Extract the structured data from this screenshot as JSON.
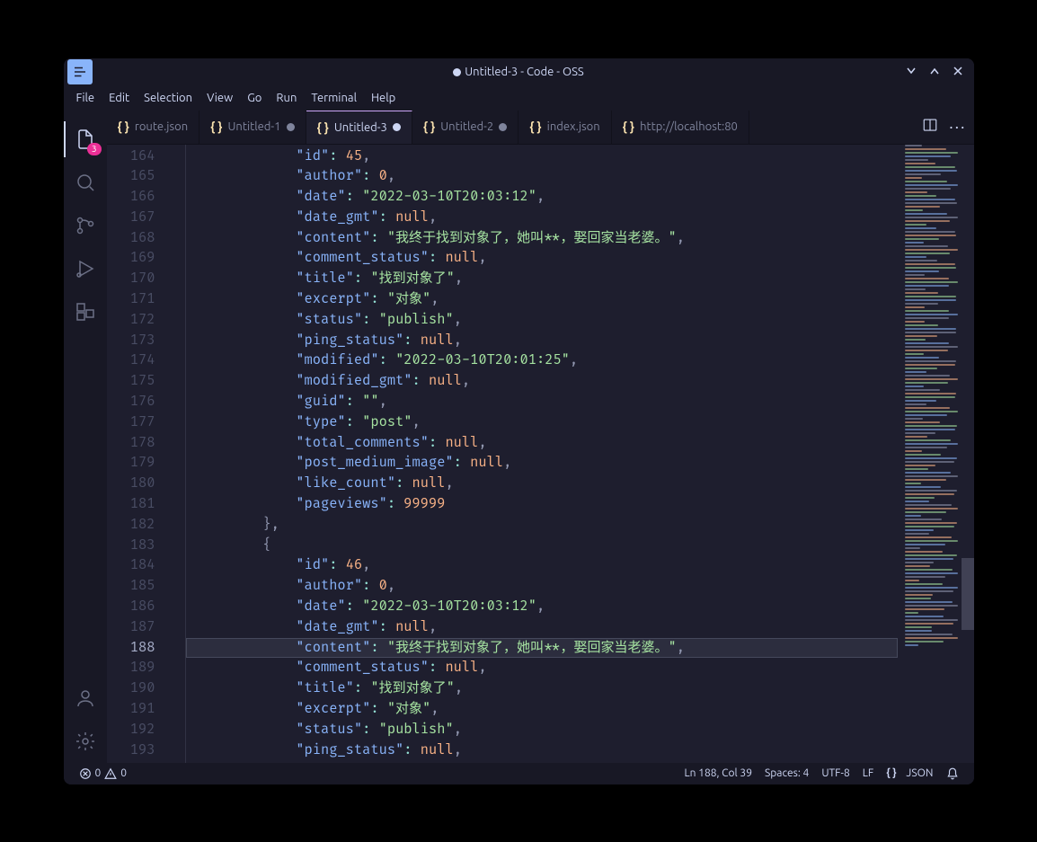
{
  "window_title": "Untitled-3 - Code - OSS",
  "menu": [
    "File",
    "Edit",
    "Selection",
    "View",
    "Go",
    "Run",
    "Terminal",
    "Help"
  ],
  "activity_badge": "3",
  "tabs": [
    {
      "label": "route.json",
      "dirty": false
    },
    {
      "label": "Untitled-1",
      "dirty": true
    },
    {
      "label": "Untitled-3",
      "dirty": true,
      "active": true
    },
    {
      "label": "Untitled-2",
      "dirty": true
    },
    {
      "label": "index.json",
      "dirty": false
    },
    {
      "label": "http://localhost:80",
      "dirty": false,
      "truncated": true
    }
  ],
  "first_line_no": 164,
  "current_line_no": 188,
  "code_lines": [
    [
      [
        "k",
        "\"id\""
      ],
      [
        "c",
        ": "
      ],
      [
        "n",
        "45"
      ],
      [
        "p",
        ","
      ]
    ],
    [
      [
        "k",
        "\"author\""
      ],
      [
        "c",
        ": "
      ],
      [
        "n",
        "0"
      ],
      [
        "p",
        ","
      ]
    ],
    [
      [
        "k",
        "\"date\""
      ],
      [
        "c",
        ": "
      ],
      [
        "s",
        "\"2022-03-10T20:03:12\""
      ],
      [
        "p",
        ","
      ]
    ],
    [
      [
        "k",
        "\"date_gmt\""
      ],
      [
        "c",
        ": "
      ],
      [
        "u",
        "null"
      ],
      [
        "p",
        ","
      ]
    ],
    [
      [
        "k",
        "\"content\""
      ],
      [
        "c",
        ": "
      ],
      [
        "s",
        "\"我终于找到对象了，她叫**，娶回家当老婆。\""
      ],
      [
        "p",
        ","
      ]
    ],
    [
      [
        "k",
        "\"comment_status\""
      ],
      [
        "c",
        ": "
      ],
      [
        "u",
        "null"
      ],
      [
        "p",
        ","
      ]
    ],
    [
      [
        "k",
        "\"title\""
      ],
      [
        "c",
        ": "
      ],
      [
        "s",
        "\"找到对象了\""
      ],
      [
        "p",
        ","
      ]
    ],
    [
      [
        "k",
        "\"excerpt\""
      ],
      [
        "c",
        ": "
      ],
      [
        "s",
        "\"对象\""
      ],
      [
        "p",
        ","
      ]
    ],
    [
      [
        "k",
        "\"status\""
      ],
      [
        "c",
        ": "
      ],
      [
        "s",
        "\"publish\""
      ],
      [
        "p",
        ","
      ]
    ],
    [
      [
        "k",
        "\"ping_status\""
      ],
      [
        "c",
        ": "
      ],
      [
        "u",
        "null"
      ],
      [
        "p",
        ","
      ]
    ],
    [
      [
        "k",
        "\"modified\""
      ],
      [
        "c",
        ": "
      ],
      [
        "s",
        "\"2022-03-10T20:01:25\""
      ],
      [
        "p",
        ","
      ]
    ],
    [
      [
        "k",
        "\"modified_gmt\""
      ],
      [
        "c",
        ": "
      ],
      [
        "u",
        "null"
      ],
      [
        "p",
        ","
      ]
    ],
    [
      [
        "k",
        "\"guid\""
      ],
      [
        "c",
        ": "
      ],
      [
        "s",
        "\"\""
      ],
      [
        "p",
        ","
      ]
    ],
    [
      [
        "k",
        "\"type\""
      ],
      [
        "c",
        ": "
      ],
      [
        "s",
        "\"post\""
      ],
      [
        "p",
        ","
      ]
    ],
    [
      [
        "k",
        "\"total_comments\""
      ],
      [
        "c",
        ": "
      ],
      [
        "u",
        "null"
      ],
      [
        "p",
        ","
      ]
    ],
    [
      [
        "k",
        "\"post_medium_image\""
      ],
      [
        "c",
        ": "
      ],
      [
        "u",
        "null"
      ],
      [
        "p",
        ","
      ]
    ],
    [
      [
        "k",
        "\"like_count\""
      ],
      [
        "c",
        ": "
      ],
      [
        "u",
        "null"
      ],
      [
        "p",
        ","
      ]
    ],
    [
      [
        "k",
        "\"pageviews\""
      ],
      [
        "c",
        ": "
      ],
      [
        "n",
        "99999"
      ]
    ],
    [
      [
        "b",
        "},"
      ]
    ],
    [
      [
        "b",
        "{"
      ]
    ],
    [
      [
        "k",
        "\"id\""
      ],
      [
        "c",
        ": "
      ],
      [
        "n",
        "46"
      ],
      [
        "p",
        ","
      ]
    ],
    [
      [
        "k",
        "\"author\""
      ],
      [
        "c",
        ": "
      ],
      [
        "n",
        "0"
      ],
      [
        "p",
        ","
      ]
    ],
    [
      [
        "k",
        "\"date\""
      ],
      [
        "c",
        ": "
      ],
      [
        "s",
        "\"2022-03-10T20:03:12\""
      ],
      [
        "p",
        ","
      ]
    ],
    [
      [
        "k",
        "\"date_gmt\""
      ],
      [
        "c",
        ": "
      ],
      [
        "u",
        "null"
      ],
      [
        "p",
        ","
      ]
    ],
    [
      [
        "k",
        "\"content\""
      ],
      [
        "c",
        ": "
      ],
      [
        "s",
        "\"我终于找到对象了，她叫**，娶回家当老婆。\""
      ],
      [
        "p",
        ","
      ]
    ],
    [
      [
        "k",
        "\"comment_status\""
      ],
      [
        "c",
        ": "
      ],
      [
        "u",
        "null"
      ],
      [
        "p",
        ","
      ]
    ],
    [
      [
        "k",
        "\"title\""
      ],
      [
        "c",
        ": "
      ],
      [
        "s",
        "\"找到对象了\""
      ],
      [
        "p",
        ","
      ]
    ],
    [
      [
        "k",
        "\"excerpt\""
      ],
      [
        "c",
        ": "
      ],
      [
        "s",
        "\"对象\""
      ],
      [
        "p",
        ","
      ]
    ],
    [
      [
        "k",
        "\"status\""
      ],
      [
        "c",
        ": "
      ],
      [
        "s",
        "\"publish\""
      ],
      [
        "p",
        ","
      ]
    ],
    [
      [
        "k",
        "\"ping_status\""
      ],
      [
        "c",
        ": "
      ],
      [
        "u",
        "null"
      ],
      [
        "p",
        ","
      ]
    ]
  ],
  "line_indent": [
    3,
    3,
    3,
    3,
    3,
    3,
    3,
    3,
    3,
    3,
    3,
    3,
    3,
    3,
    3,
    3,
    3,
    3,
    2,
    2,
    3,
    3,
    3,
    3,
    3,
    3,
    3,
    3,
    3,
    3
  ],
  "status": {
    "errors": "0",
    "warnings": "0",
    "cursor": "Ln 188, Col 39",
    "indent": "Spaces: 4",
    "encoding": "UTF-8",
    "eol": "LF",
    "language": "JSON"
  }
}
